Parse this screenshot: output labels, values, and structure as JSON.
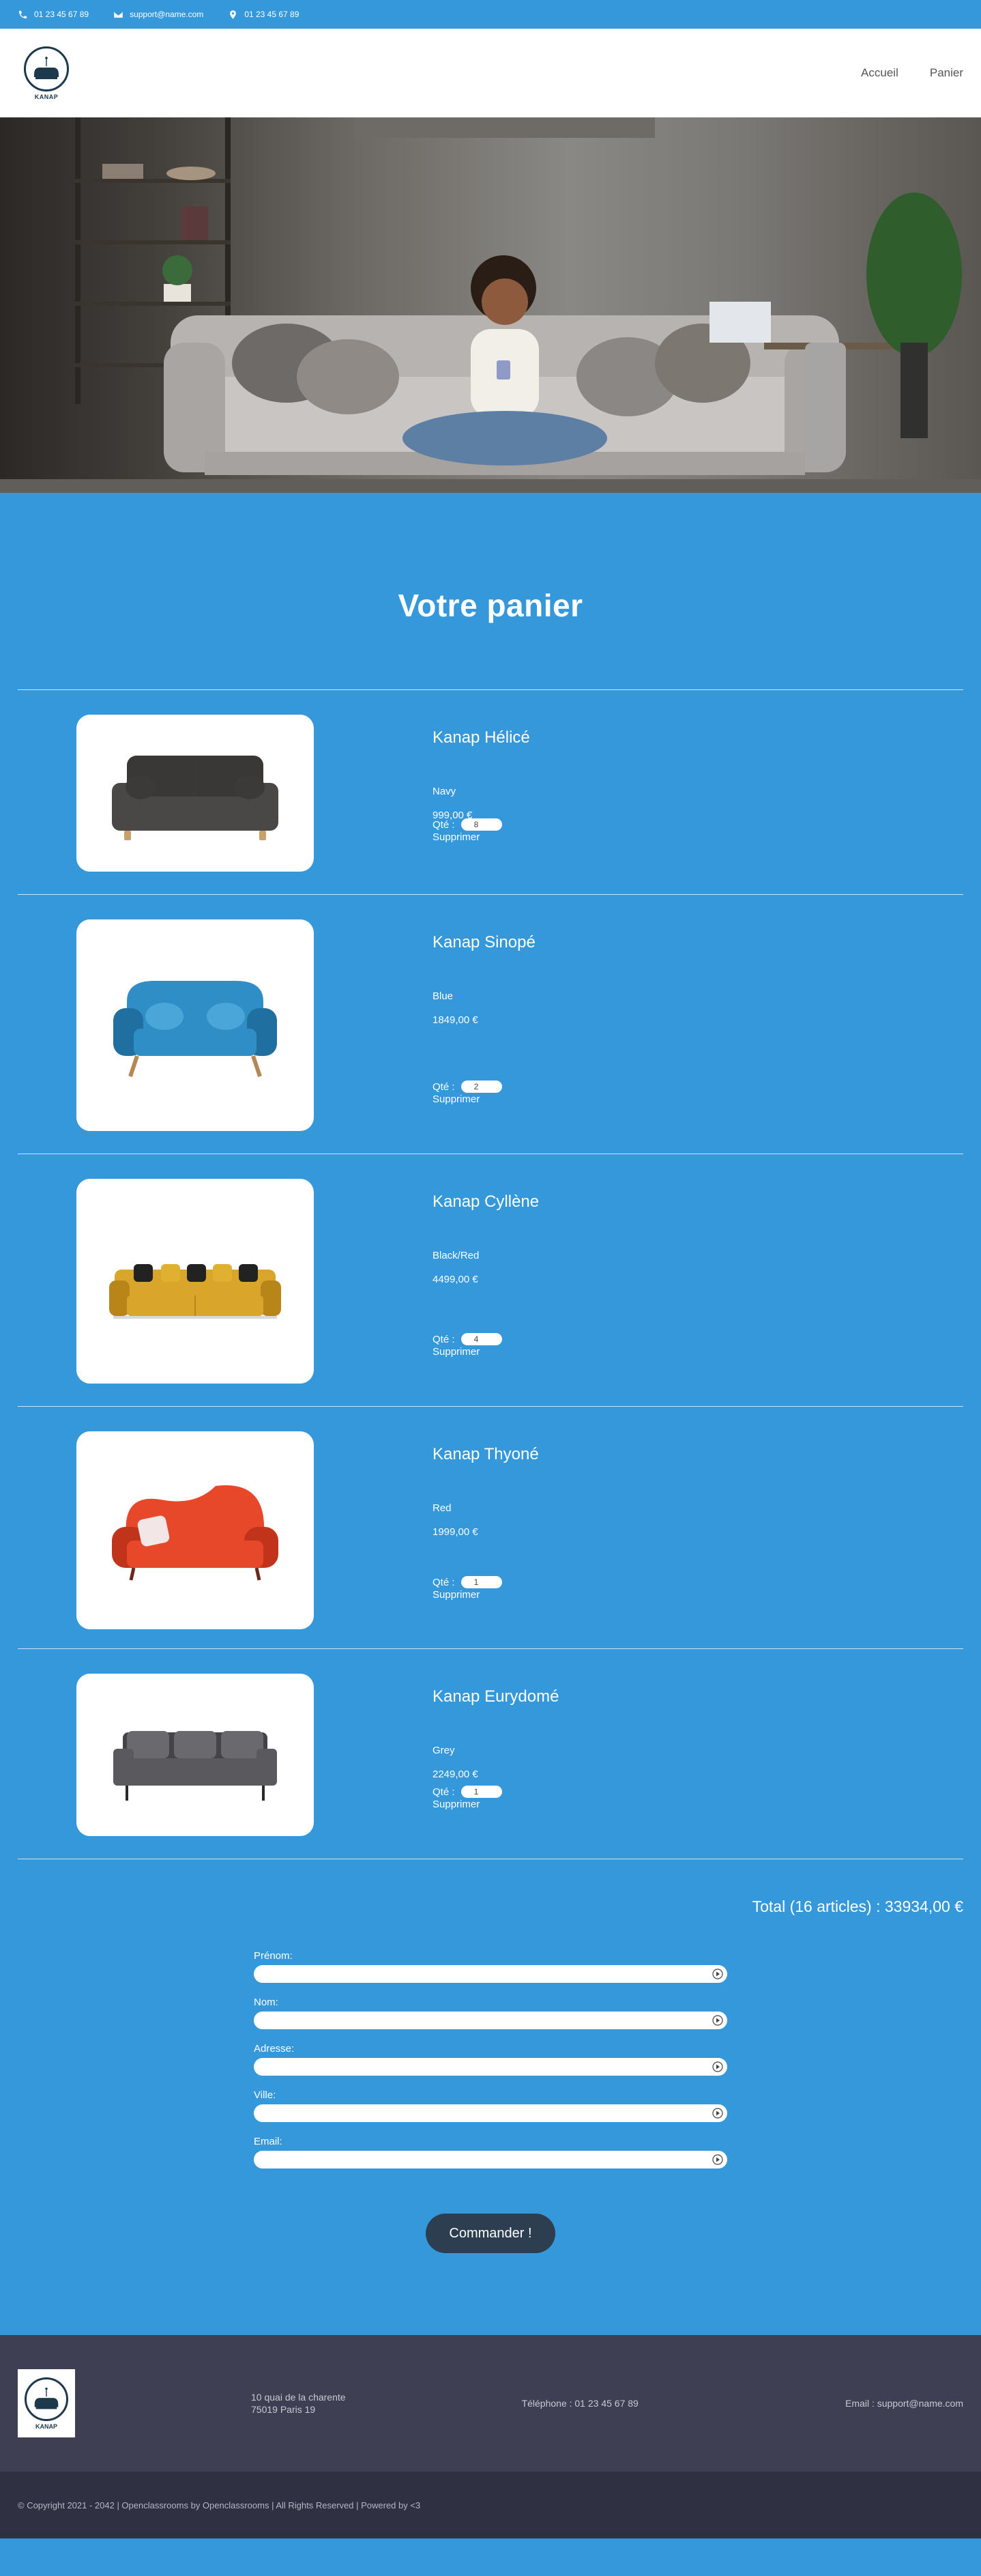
{
  "topbar": {
    "phone": "01 23 45 67 89",
    "email": "support@name.com",
    "location": "01 23 45 67 89"
  },
  "header": {
    "logo_text": "KANAP",
    "nav": [
      "Accueil",
      "Panier"
    ]
  },
  "cart": {
    "title": "Votre panier",
    "qty_label": "Qté : ",
    "delete_label": "Supprimer",
    "items": [
      {
        "name": "Kanap Hélicé",
        "color": "Navy",
        "price": "999,00 €",
        "quantity": "8",
        "sofa_color": "#4a4846",
        "sofa_dark": "#3a3836",
        "legs": "#c9a06a",
        "pillows": "#3c3a38"
      },
      {
        "name": "Kanap Sinopé",
        "color": "Blue",
        "price": "1849,00 €",
        "quantity": "2",
        "sofa_color": "#2f8ec6",
        "sofa_dark": "#1f6fa0",
        "legs": "#b58756",
        "pillows": "#4aa6d8"
      },
      {
        "name": "Kanap Cyllène",
        "color": "Black/Red",
        "price": "4499,00 €",
        "quantity": "4",
        "sofa_color": "#d9a52a",
        "sofa_dark": "#b78518",
        "legs": "#2a2a2a",
        "pillows": "#222222"
      },
      {
        "name": "Kanap Thyoné",
        "color": "Red",
        "price": "1999,00 €",
        "quantity": "1",
        "sofa_color": "#e8482a",
        "sofa_dark": "#c1331a",
        "legs": "#6a2a1a",
        "pillows": "#f2e6e6"
      },
      {
        "name": "Kanap Eurydomé",
        "color": "Grey",
        "price": "2249,00 €",
        "quantity": "1",
        "sofa_color": "#5a5a5e",
        "sofa_dark": "#444448",
        "legs": "#2a2a2a",
        "pillows": "#6a6a6e"
      }
    ],
    "total_text": "Total (16 articles) : 33934,00 €"
  },
  "form": {
    "fields": [
      "Prénom:",
      "Nom:",
      "Adresse:",
      "Ville:",
      "Email:"
    ],
    "submit": "Commander !"
  },
  "footer": {
    "logo_text": "KANAP",
    "address_line1": "10 quai de la charente",
    "address_line2": "75019 Paris 19",
    "phone": "Téléphone : 01 23 45 67 89",
    "email": "Email : support@name.com",
    "copyright": "© Copyright 2021 - 2042 | Openclassrooms by Openclassrooms | All Rights Reserved | Powered by <3"
  }
}
